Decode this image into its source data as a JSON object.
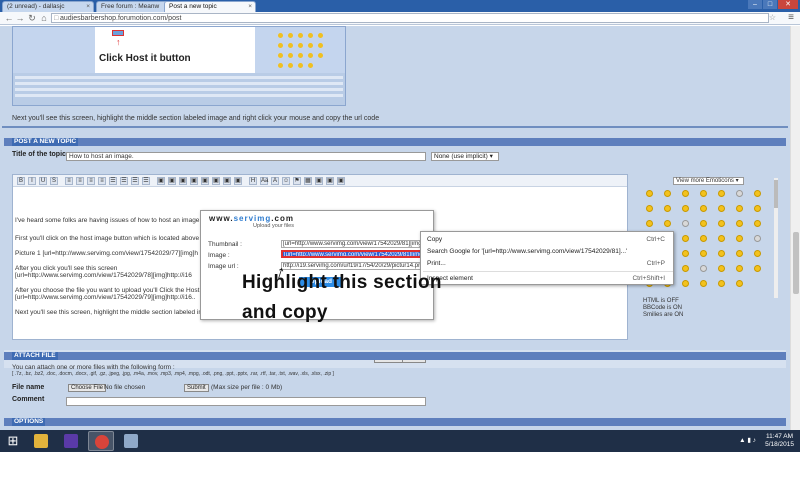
{
  "browser": {
    "tabs": [
      {
        "label": "(2 unread) - dallasjc"
      },
      {
        "label": "Free forum : Meanw"
      },
      {
        "label": "Post a new topic"
      }
    ],
    "url": "audiesbarbershop.forumotion.com/post",
    "window_controls": {
      "minimize": "–",
      "maximize": "□",
      "close": "✕"
    }
  },
  "page": {
    "preview_click_host": "Click Host it button",
    "caption": "Next you'll see this screen, highlight the middle section labeled image and right click your mouse and copy the url code",
    "post_section_title": "POST A NEW TOPIC",
    "title_label": "Title of the topic",
    "title_value": "How to host an image.",
    "icon_select": "None (use implicit)",
    "toolbar_buttons": [
      "B",
      "I",
      "U",
      "S",
      "≡",
      "≡",
      "≡",
      "≡",
      "☰",
      "☰",
      "☰",
      "☰",
      "▣",
      "▣",
      "▣",
      "▣",
      "▣",
      "▣",
      "▣",
      "▣",
      "H",
      "Aa",
      "A",
      "☺",
      "⚑",
      "▦",
      "▣",
      "▣",
      "▣"
    ],
    "editor_lines": [
      "I've heard some folks are having issues of how to host an image.",
      "First you'll click on the host image button which is located above t",
      "Picture 1 [url=http://www.servimg.com/view/17542029/77][img]h",
      "After you click you'll see this screen",
      "[url=http://www.servimg.com/view/17542029/78][img]http://i16",
      "After you choose the file you want to upload you'll Click the Host",
      "[url=http://www.servimg.com/view/17542029/79][img]http://i16..",
      "Next you'll see this screen, highlight the middle section labeled im"
    ],
    "servimg": {
      "logo_prefix": "www.",
      "logo_main": "servimg",
      "logo_suffix": ".com",
      "slogan": "Upload your files",
      "thumbnail_label": "Thumbnail :",
      "thumbnail_value": "[url=http://www.servimg.com/view/17542029/81][img]http://i",
      "image_label": "Image :",
      "image_value": "[url=http://www.servimg.com/view/17542029/81][img]http://i",
      "image_url_label": "Image url :",
      "image_url_value": "http://i19.servimg.com/u/f19/17/54/20/29/pictur14.png",
      "upload_label": "Upload"
    },
    "context_menu": [
      {
        "label": "Copy",
        "shortcut": "Ctrl+C"
      },
      {
        "label": "Search Google for '[url=http://www.servimg.com/view/17542029/81]...'",
        "shortcut": ""
      },
      {
        "label": "Print...",
        "shortcut": "Ctrl+P"
      },
      {
        "label": "Inspect element",
        "shortcut": "Ctrl+Shift+I"
      }
    ],
    "annotation_line1": "Highlight this section",
    "annotation_line2": "and copy",
    "emoticons_select": "View more Emoticons",
    "html_status": "HTML is OFF",
    "bbcode_status": "BBCode is ON",
    "smilies_status": "Smilies are ON",
    "preview_button": "Preview",
    "send_button": "Send",
    "attach_title": "ATTACH FILE",
    "attach_desc": "You can attach one or more files with the following form :",
    "attach_types": "[ .7z, .bz, .bz2, .doc, .docm, .docx, .gif, .gz, .jpeg, .jpg, .m4a, .mov, .mp3, .mp4, .mpg, .odt, .png, .ppt, .pptx, .rar, .rtf, .tar, .txt, .wav, .xls, .xlsx, .zip ]",
    "file_name_label": "File name",
    "choose_file_button": "Choose File",
    "no_file_text": "No file chosen",
    "submit_button": "Submit",
    "max_size": "(Max size per file : 0 Mb)",
    "comment_label": "Comment",
    "options_title": "OPTIONS"
  },
  "taskbar": {
    "time": "11:47 AM",
    "date": "5/18/2015"
  },
  "colors": {
    "page_bg": "#c7d6ea",
    "section_header": "#3e6bb3",
    "selection": "#2f62d6",
    "highlight_border": "#e12f2f",
    "upload_button": "#2c8ce6"
  }
}
